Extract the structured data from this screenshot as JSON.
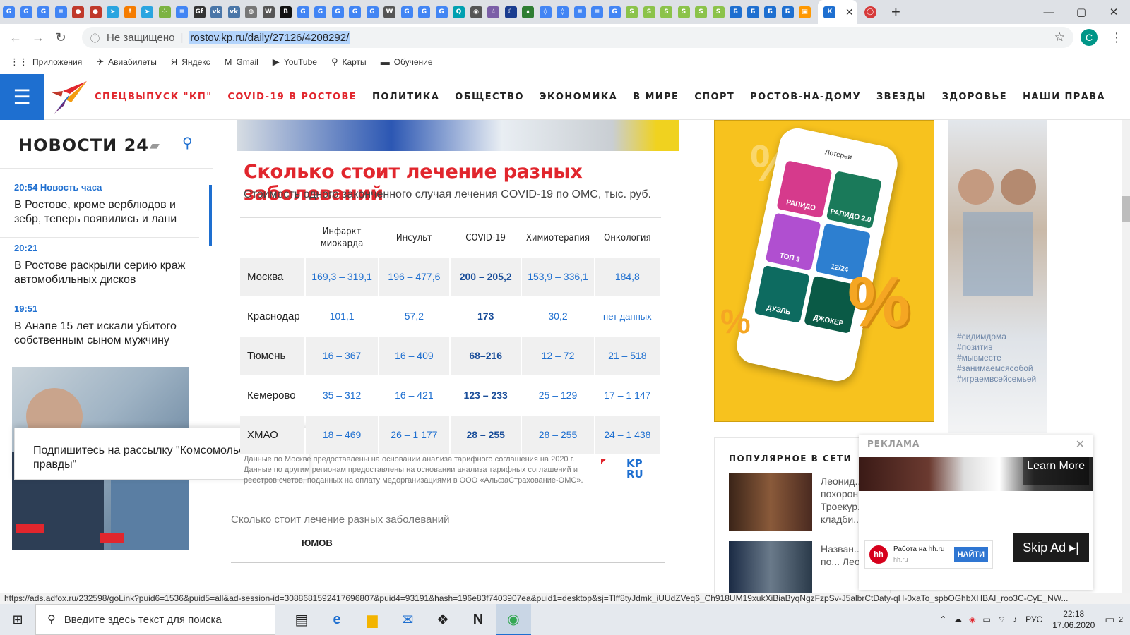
{
  "browser": {
    "tab_icons": [
      {
        "icon": "g-icon",
        "color": "#4285f4",
        "glyph": "G"
      },
      {
        "icon": "g-icon",
        "color": "#4285f4",
        "glyph": "G"
      },
      {
        "icon": "g-icon",
        "color": "#4285f4",
        "glyph": "G"
      },
      {
        "icon": "docs-icon",
        "color": "#4285f4",
        "glyph": "≡"
      },
      {
        "icon": "bug-icon",
        "color": "#c0392b",
        "glyph": "●"
      },
      {
        "icon": "bug-icon",
        "color": "#c0392b",
        "glyph": "●"
      },
      {
        "icon": "telegram-icon",
        "color": "#2aa5e0",
        "glyph": "➤"
      },
      {
        "icon": "firefox-icon",
        "color": "#f57c00",
        "glyph": "!"
      },
      {
        "icon": "telegram-icon",
        "color": "#2aa5e0",
        "glyph": "➤"
      },
      {
        "icon": "dots-icon",
        "color": "#7cb342",
        "glyph": "⁘"
      },
      {
        "icon": "docs-icon",
        "color": "#4285f4",
        "glyph": "≡"
      },
      {
        "icon": "gf-icon",
        "color": "#333333",
        "glyph": "Gf"
      },
      {
        "icon": "vk-icon",
        "color": "#4a76a8",
        "glyph": "vk"
      },
      {
        "icon": "vk-icon",
        "color": "#4a76a8",
        "glyph": "vk"
      },
      {
        "icon": "globe-icon",
        "color": "#777777",
        "glyph": "◍"
      },
      {
        "icon": "wiki-icon",
        "color": "#555555",
        "glyph": "W"
      },
      {
        "icon": "b-icon",
        "color": "#111111",
        "glyph": "B"
      },
      {
        "icon": "g-icon",
        "color": "#4285f4",
        "glyph": "G"
      },
      {
        "icon": "g-icon",
        "color": "#4285f4",
        "glyph": "G"
      },
      {
        "icon": "g-icon",
        "color": "#4285f4",
        "glyph": "G"
      },
      {
        "icon": "g-icon",
        "color": "#4285f4",
        "glyph": "G"
      },
      {
        "icon": "g-icon",
        "color": "#4285f4",
        "glyph": "G"
      },
      {
        "icon": "wiki-icon",
        "color": "#555555",
        "glyph": "W"
      },
      {
        "icon": "g-icon",
        "color": "#4285f4",
        "glyph": "G"
      },
      {
        "icon": "g-icon",
        "color": "#4285f4",
        "glyph": "G"
      },
      {
        "icon": "g-icon",
        "color": "#4285f4",
        "glyph": "G"
      },
      {
        "icon": "search-circle-icon",
        "color": "#00a0b0",
        "glyph": "Q"
      },
      {
        "icon": "camera-icon",
        "color": "#555555",
        "glyph": "◉"
      },
      {
        "icon": "star-icon",
        "color": "#7b5ea7",
        "glyph": "☆"
      },
      {
        "icon": "moon-icon",
        "color": "#1a3c8f",
        "glyph": "☾"
      },
      {
        "icon": "star-icon",
        "color": "#2e7d32",
        "glyph": "★"
      },
      {
        "icon": "drop-icon",
        "color": "#4285f4",
        "glyph": "◊"
      },
      {
        "icon": "drop-icon",
        "color": "#4285f4",
        "glyph": "◊"
      },
      {
        "icon": "docs-icon",
        "color": "#4285f4",
        "glyph": "≡"
      },
      {
        "icon": "docs-icon",
        "color": "#4285f4",
        "glyph": "≡"
      },
      {
        "icon": "g-icon",
        "color": "#4285f4",
        "glyph": "G"
      },
      {
        "icon": "s-icon",
        "color": "#8bc34a",
        "glyph": "S"
      },
      {
        "icon": "s-icon",
        "color": "#8bc34a",
        "glyph": "S"
      },
      {
        "icon": "s-icon",
        "color": "#8bc34a",
        "glyph": "S"
      },
      {
        "icon": "s-icon",
        "color": "#8bc34a",
        "glyph": "S"
      },
      {
        "icon": "s-icon",
        "color": "#8bc34a",
        "glyph": "S"
      },
      {
        "icon": "s-icon",
        "color": "#8bc34a",
        "glyph": "S"
      },
      {
        "icon": "b-letter-icon",
        "color": "#1e6fd0",
        "glyph": "Б"
      },
      {
        "icon": "b-letter-icon",
        "color": "#1e6fd0",
        "glyph": "Б"
      },
      {
        "icon": "b-letter-icon",
        "color": "#1e6fd0",
        "glyph": "Б"
      },
      {
        "icon": "b-letter-icon",
        "color": "#1e6fd0",
        "glyph": "Б"
      },
      {
        "icon": "orange-icon",
        "color": "#ff9800",
        "glyph": "▣"
      }
    ],
    "url_prefix": "Не защищено",
    "url": "rostov.kp.ru/daily/27126/4208292/",
    "profile_letter": "С",
    "bookmarks": [
      {
        "icon": "apps-icon",
        "glyph": "⋮⋮",
        "label": "Приложения"
      },
      {
        "icon": "plane-icon",
        "glyph": "✈",
        "label": "Авиабилеты"
      },
      {
        "icon": "yandex-icon",
        "glyph": "Я",
        "label": "Яндекс"
      },
      {
        "icon": "gmail-icon",
        "glyph": "M",
        "label": "Gmail"
      },
      {
        "icon": "youtube-icon",
        "glyph": "▶",
        "label": "YouTube"
      },
      {
        "icon": "maps-icon",
        "glyph": "⚲",
        "label": "Карты"
      },
      {
        "icon": "folder-icon",
        "glyph": "▬",
        "label": "Обучение"
      }
    ]
  },
  "site": {
    "nav": [
      {
        "label": "СПЕЦВЫПУСК \"КП\"",
        "red": true
      },
      {
        "label": "COVID-19 В РОСТОВЕ",
        "red": true
      },
      {
        "label": "ПОЛИТИКА",
        "red": false
      },
      {
        "label": "ОБЩЕСТВО",
        "red": false
      },
      {
        "label": "ЭКОНОМИКА",
        "red": false
      },
      {
        "label": "В МИРЕ",
        "red": false
      },
      {
        "label": "СПОРТ",
        "red": false
      },
      {
        "label": "РОСТОВ-НА-ДОМУ",
        "red": false
      },
      {
        "label": "ЗВЕЗДЫ",
        "red": false
      },
      {
        "label": "ЗДОРОВЬЕ",
        "red": false
      },
      {
        "label": "НАШИ ПРАВА",
        "red": false
      }
    ],
    "news_title": "НОВОСТИ 24",
    "news": [
      {
        "time": "20:54 Новость часа",
        "text": "В Ростове, кроме верблюдов и зебр, теперь появились и лани"
      },
      {
        "time": "20:21",
        "text": "В Ростове раскрыли серию краж автомобильных дисков"
      },
      {
        "time": "19:51",
        "text": "В Анапе 15 лет искали убитого собственным сыном мужчину"
      }
    ],
    "subscribe_text": "Подпишитесь на рассылку \"Комсомольской правды\"",
    "subscribe_close": "×"
  },
  "article": {
    "info_title": "Сколько стоит лечение разных заболеваний",
    "info_subtitle": "Стоимость одного законченного случая лечения  COVID-19 по ОМС, тыс. руб.",
    "headers": [
      "",
      "Инфаркт миокарда",
      "Инсульт",
      "COVID-19",
      "Химиотерапия",
      "Онкология"
    ],
    "rows": [
      {
        "city": "Москва",
        "values": [
          "169,3 – 319,1",
          "196 – 477,6",
          "200 – 205,2",
          "153,9 – 336,1",
          "184,8"
        ]
      },
      {
        "city": "Краснодар",
        "values": [
          "101,1",
          "57,2",
          "173",
          "30,2",
          "нет данных"
        ]
      },
      {
        "city": "Тюмень",
        "values": [
          "16 – 367",
          "16 – 409",
          "68–216",
          "12 – 72",
          "21 – 518"
        ]
      },
      {
        "city": "Кемерово",
        "values": [
          "35 – 312",
          "16 – 421",
          "123 – 233",
          "25 – 129",
          "17 – 1 147"
        ]
      },
      {
        "city": "ХМАО",
        "values": [
          "18 – 469",
          "26 – 1 177",
          "28 – 255",
          "28 – 255",
          "24 – 1 438"
        ]
      }
    ],
    "footnote": "Данные по Москве предоставлены на основании анализа тарифного соглашения на 2020 г. Данные по другим регионам предоставлены на основании анализа тарифных соглашений и реестров счетов, поданных на оплату медорганизациями в ООО «АльфаСтрахование-ОМС».",
    "kp_logo": "KP RU",
    "caption": "Сколько стоит лечение разных заболеваний",
    "tail_text": "ЮМОВ"
  },
  "ads": {
    "phone_header": "Лотереи",
    "tiles": [
      {
        "label": "РАПИДО",
        "color": "#d63a8c"
      },
      {
        "label": "РАПИДО 2.0",
        "color": "#1a7a5a"
      },
      {
        "label": "ТОП 3",
        "color": "#b04fd0"
      },
      {
        "label": "12/24",
        "color": "#2d7fd0"
      },
      {
        "label": "ДУЭЛЬ",
        "color": "#0d6b60"
      },
      {
        "label": "ДЖОКЕР",
        "color": "#0a5a46"
      }
    ],
    "tags": [
      "#сидимдома",
      "#позитив",
      "#мывместе",
      "#занимаемсясобой",
      "#играемвсейсемьей"
    ],
    "popular_title": "ПОПУЛЯРНОЕ В СЕТИ",
    "popular": [
      {
        "text": "Леонид... похорон... Троекур... кладби..."
      },
      {
        "text": "Назван... будет по... Леонид..."
      }
    ],
    "video_label": "РЕКЛАМА",
    "learn_more": "Learn More",
    "skip_ad": "Skip Ad ▸|",
    "hh_title": "Работа на hh.ru",
    "hh_domain": "hh.ru",
    "hh_button": "НАЙТИ",
    "hh_logo": "hh"
  },
  "status_url": "https://ads.adfox.ru/232598/goLink?puid6=1536&puid5=all&ad-session-id=3088681592417696807&puid4=93191&hash=196e83f7403907ea&puid1=desktop&sj=Tlff8tyJdmk_iUUdZVeq6_Ch918UM19xukXiBiaByqNgzFzpSv-J5albrCtDaty-qH-0xaTo_spbOGhbXHBAI_roo3C-CyE_NW...",
  "taskbar": {
    "search_placeholder": "Введите здесь текст для поиска",
    "lang": "РУС",
    "time": "22:18",
    "date": "17.06.2020",
    "notifications": "2"
  }
}
